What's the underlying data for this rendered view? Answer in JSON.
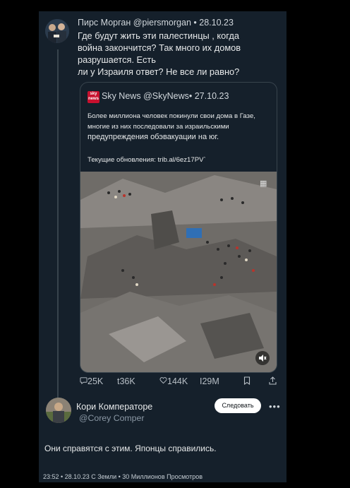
{
  "tweet": {
    "author_name": "Пирс Морган",
    "author_handle": "@piersmorgan",
    "separator": "•",
    "date": "28.10.23",
    "text_lines": [
      "Где будут жить эти палестинцы , когда",
      "война закончится? Так много их домов",
      "разрушается. Есть",
      "ли у Израиля ответ? Не все ли равно?"
    ]
  },
  "quote": {
    "logo_text": "sky news",
    "author_name": "Sky News",
    "author_handle": "@SkyNews",
    "separator": "•",
    "date": "27.10.23",
    "text_lines": [
      "Более миллиона человек покинули свои дома в Газе,",
      "многие из них последовали за израильскими",
      "предупреждения обэвакуации на юг."
    ],
    "link_text": "Текущие обновления: trib.al/6ez17PV`",
    "media_volume_icon": "speaker-muted-icon",
    "media_corner_icon": "grid-icon"
  },
  "actions": {
    "replies": "25K",
    "retweets": "36K",
    "likes": "144K",
    "views": "29M"
  },
  "reply": {
    "author_name": "Кори Комператоре",
    "author_handle": "@Corey Comper",
    "follow_label": "Следовать",
    "more_label": "•••",
    "text": "Они справятся с этим. Японцы справились."
  },
  "meta": {
    "line": "23:52 • 28.10.23 С Земли • 30 Миллионов Просмотров"
  },
  "colors": {
    "background": "#15202b",
    "border": "#38444d",
    "text": "#e7e9ea",
    "secondary_text": "#8b98a5"
  }
}
